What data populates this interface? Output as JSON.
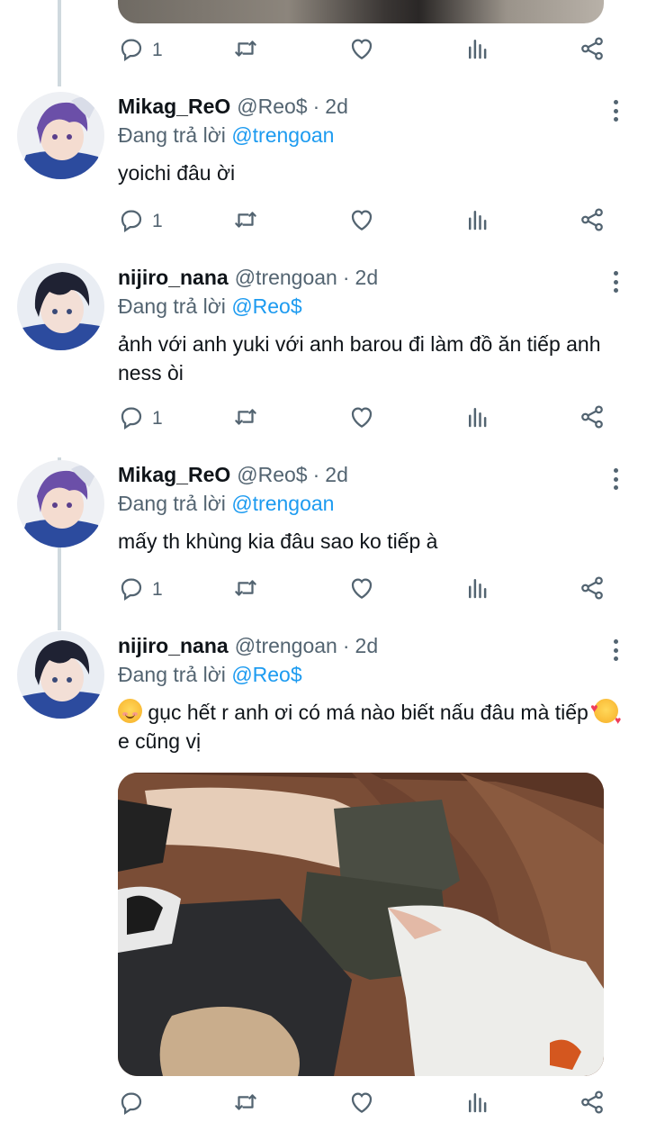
{
  "top_tweet": {
    "reply_count": "1"
  },
  "tweets": [
    {
      "name": "Mikag_ReO",
      "handle": "@Reo$",
      "separator": "·",
      "time": "2d",
      "replying_prefix": "Đang trả lời",
      "replying_to": "@trengoan",
      "text": "yoichi đâu ời",
      "reply_count": "1",
      "avatar": "purple-hair-anime-avatar"
    },
    {
      "name": "nijiro_nana",
      "handle": "@trengoan",
      "separator": "·",
      "time": "2d",
      "replying_prefix": "Đang trả lời",
      "replying_to": "@Reo$",
      "text": "ảnh với anh yuki với anh barou đi làm đồ ăn tiếp anh ness òi",
      "reply_count": "1",
      "avatar": "dark-hair-anime-avatar"
    },
    {
      "name": "Mikag_ReO",
      "handle": "@Reo$",
      "separator": "·",
      "time": "2d",
      "replying_prefix": "Đang trả lời",
      "replying_to": "@trengoan",
      "text": "mấy th khùng kia đâu sao ko tiếp à",
      "reply_count": "1",
      "avatar": "purple-hair-anime-avatar"
    },
    {
      "name": "nijiro_nana",
      "handle": "@trengoan",
      "separator": "·",
      "time": "2d",
      "replying_prefix": "Đang trả lời",
      "replying_to": "@Reo$",
      "text_part1": " gục hết r anh ơi có má nào biết nấu đâu mà tiếp ",
      "text_part2": " e cũng vị",
      "reply_count": "",
      "avatar": "dark-hair-anime-avatar"
    }
  ],
  "icons": {
    "reply": "reply-bubble-icon",
    "retweet": "retweet-icon",
    "like": "heart-icon",
    "views": "views-bar-chart-icon",
    "share": "share-icon",
    "more": "more-vertical-icon"
  },
  "colors": {
    "link": "#1d9bf0",
    "secondary": "#536471",
    "text": "#0f1419",
    "thread_line": "#cfd9de"
  }
}
